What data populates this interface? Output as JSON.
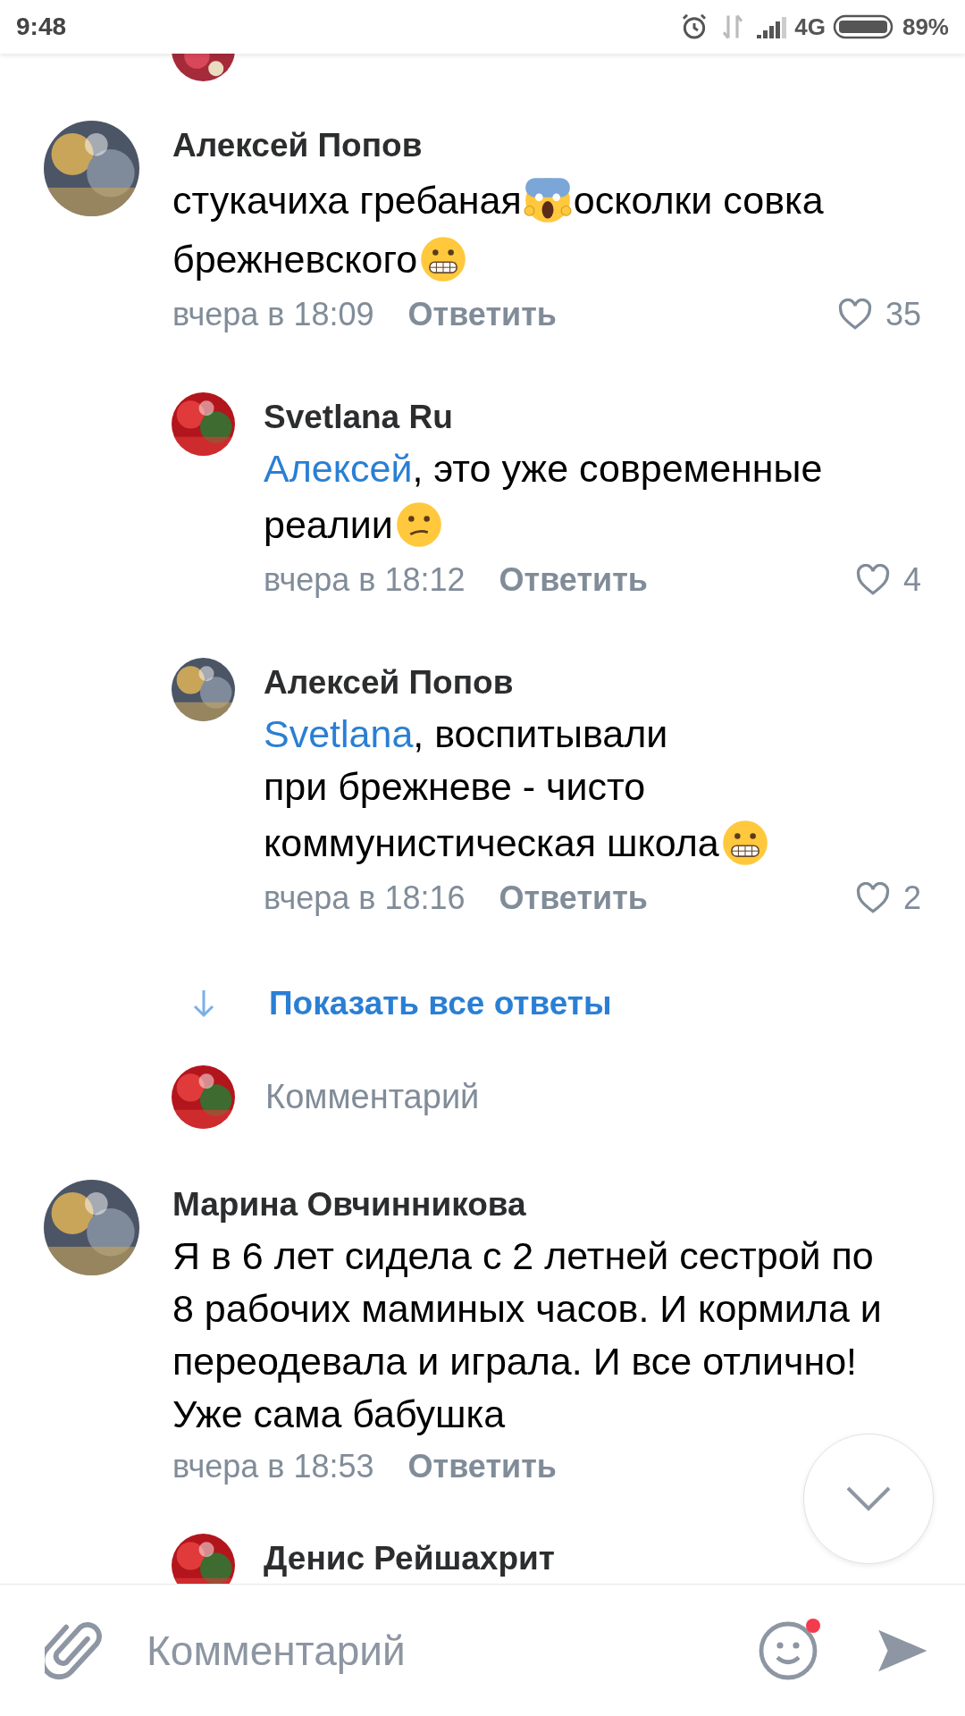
{
  "status_bar": {
    "time": "9:48",
    "network": "4G",
    "battery": "89%"
  },
  "comments": [
    {
      "kind": "top",
      "author": "Алексей Попов",
      "lines": [
        [
          {
            "kind": "text",
            "text": "стукачиха гребаная"
          },
          {
            "kind": "scream"
          },
          {
            "kind": "text",
            "text": "осколки совка"
          }
        ],
        [
          {
            "kind": "text",
            "text": "брежневского"
          },
          {
            "kind": "grimace"
          }
        ]
      ],
      "time": "вчера в 18:09",
      "reply": "Ответить",
      "likes": "35"
    },
    {
      "kind": "reply",
      "author": "Svetlana Ru",
      "lines": [
        [
          {
            "kind": "mention",
            "text": "Алексей"
          },
          {
            "kind": "text",
            "text": ", это уже современные"
          }
        ],
        [
          {
            "kind": "text",
            "text": "реалии"
          },
          {
            "kind": "confused"
          }
        ]
      ],
      "time": "вчера в 18:12",
      "reply": "Ответить",
      "likes": "4"
    },
    {
      "kind": "reply",
      "author": "Алексей Попов",
      "lines": [
        [
          {
            "kind": "mention",
            "text": "Svetlana"
          },
          {
            "kind": "text",
            "text": ", воспитывали"
          }
        ],
        [
          {
            "kind": "text",
            "text": "при брежневе - чисто"
          }
        ],
        [
          {
            "kind": "text",
            "text": "коммунистическая школа"
          },
          {
            "kind": "grimace"
          }
        ]
      ],
      "time": "вчера в 18:16",
      "reply": "Ответить",
      "likes": "2"
    },
    {
      "kind": "more",
      "text": "Показать все ответы"
    },
    {
      "kind": "compose",
      "placeholder": "Комментарий"
    },
    {
      "kind": "top",
      "author": "Марина Овчинникова",
      "lines": [
        [
          {
            "kind": "text",
            "text": "Я в 6 лет сидела с 2 летней сестрой по"
          }
        ],
        [
          {
            "kind": "text",
            "text": "8 рабочих маминых часов. И кормила и"
          }
        ],
        [
          {
            "kind": "text",
            "text": "переодевала и играла. И все отлично!"
          }
        ],
        [
          {
            "kind": "text",
            "text": "Уже сама бабушка"
          }
        ]
      ],
      "time": "вчера в 18:53",
      "reply": "Ответить"
    },
    {
      "kind": "reply",
      "author": "Денис Рейшахрит"
    }
  ],
  "input_bar": {
    "placeholder": "Комментарий",
    "emoji_badge": true
  }
}
